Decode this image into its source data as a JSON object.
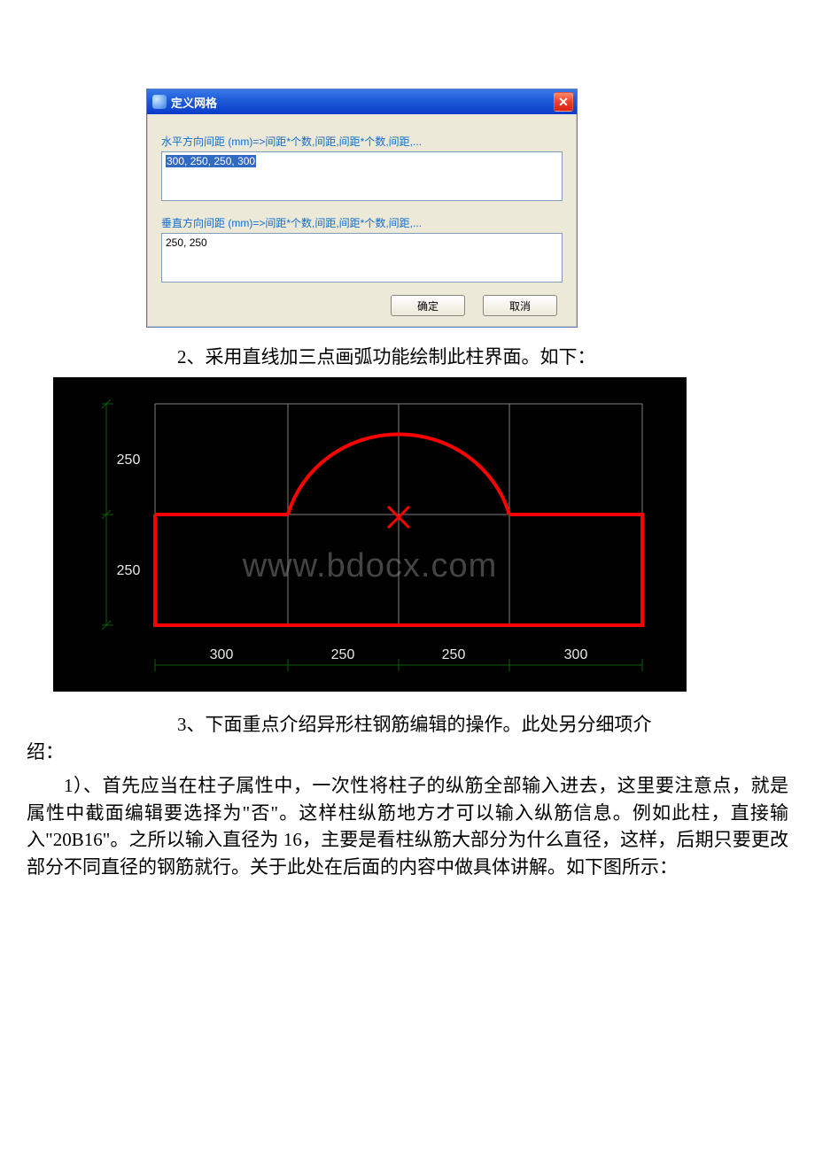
{
  "dialog": {
    "title": "定义网格",
    "label_h": "水平方向间距 (mm)=>间距*个数,间距,间距*个数,间距,...",
    "value_h": "300, 250, 250, 300",
    "label_v": "垂直方向间距 (mm)=>间距*个数,间距,间距*个数,间距,...",
    "value_v": "250, 250",
    "ok": "确定",
    "cancel": "取消"
  },
  "para2": "2、采用直线加三点画弧功能绘制此柱界面。如下：",
  "cad": {
    "watermark": "www.bdocx.com",
    "rows": [
      "250",
      "250"
    ],
    "cols": [
      "300",
      "250",
      "250",
      "300"
    ]
  },
  "para3_lead": "3、下面重点介绍异形柱钢筋编辑的操作。此处另分细项介绍：",
  "para3_tail": "绍：",
  "para_body": "1）、首先应当在柱子属性中，一次性将柱子的纵筋全部输入进去，这里要注意点，就是属性中截面编辑要选择为\"否\"。这样柱纵筋地方才可以输入纵筋信息。例如此柱，直接输入\"20B16\"。之所以输入直径为 16，主要是看柱纵筋大部分为什么直径，这样，后期只要更改部分不同直径的钢筋就行。关于此处在后面的内容中做具体讲解。如下图所示："
}
